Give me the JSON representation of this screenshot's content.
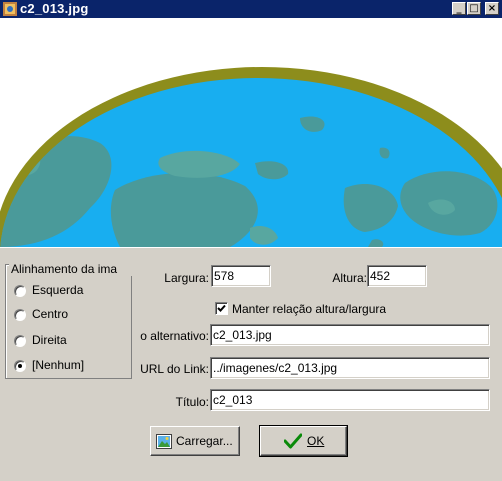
{
  "window": {
    "title": "c2_013.jpg",
    "controls": {
      "minimize": "_",
      "maximize": "□",
      "close": "×"
    }
  },
  "image": {
    "description_icon": "globe-image"
  },
  "alignment": {
    "legend": "Alinhamento da ima",
    "options": [
      {
        "label": "Esquerda",
        "checked": false
      },
      {
        "label": "Centro",
        "checked": false
      },
      {
        "label": "Direita",
        "checked": false
      },
      {
        "label": "[Nenhum]",
        "checked": true
      }
    ]
  },
  "form": {
    "width_label": "Largura:",
    "width_value": "578",
    "height_label": "Altura:",
    "height_value": "452",
    "keep_ratio_label": "Manter relação altura/largura",
    "keep_ratio_checked": true,
    "alt_label": "o alternativo:",
    "alt_value": "c2_013.jpg",
    "url_label": "URL do Link:",
    "url_value": "../imagenes/c2_013.jpg",
    "title_label": "Título:",
    "title_value": "c2_013"
  },
  "buttons": {
    "load_label": "Carregar...",
    "ok_label": "OK"
  },
  "colors": {
    "titlebar": "#0a246a",
    "ocean": "#18aef0",
    "land": "#4a9a9a",
    "rim": "#8d8d1c",
    "face": "#d4d0c8"
  }
}
